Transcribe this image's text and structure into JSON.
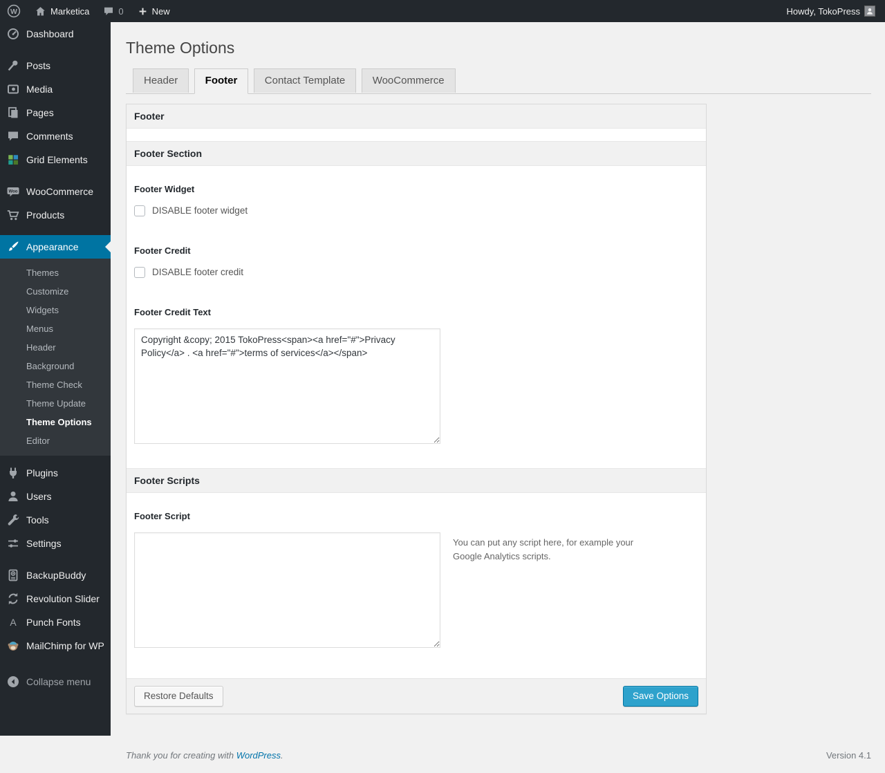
{
  "admin_bar": {
    "wp_logo": "W",
    "site_name": "Marketica",
    "comments_count": "0",
    "new_label": "New",
    "howdy": "Howdy, TokoPress"
  },
  "sidebar": {
    "menu": [
      {
        "label": "Dashboard"
      },
      {
        "label": "Posts"
      },
      {
        "label": "Media"
      },
      {
        "label": "Pages"
      },
      {
        "label": "Comments"
      },
      {
        "label": "Grid Elements"
      },
      {
        "label": "WooCommerce"
      },
      {
        "label": "Products"
      },
      {
        "label": "Appearance"
      },
      {
        "label": "Plugins"
      },
      {
        "label": "Users"
      },
      {
        "label": "Tools"
      },
      {
        "label": "Settings"
      },
      {
        "label": "BackupBuddy"
      },
      {
        "label": "Revolution Slider"
      },
      {
        "label": "Punch Fonts"
      },
      {
        "label": "MailChimp for WP"
      },
      {
        "label": "Collapse menu"
      }
    ],
    "appearance_submenu": [
      "Themes",
      "Customize",
      "Widgets",
      "Menus",
      "Header",
      "Background",
      "Theme Check",
      "Theme Update",
      "Theme Options",
      "Editor"
    ],
    "current_submenu_item": "Theme Options"
  },
  "main": {
    "page_title": "Theme Options",
    "tabs": [
      {
        "label": "Header",
        "active": false
      },
      {
        "label": "Footer",
        "active": true
      },
      {
        "label": "Contact Template",
        "active": false
      },
      {
        "label": "WooCommerce",
        "active": false
      }
    ],
    "panel": {
      "title": "Footer",
      "section_title": "Footer Section",
      "footer_widget_label": "Footer Widget",
      "footer_widget_checkbox": "DISABLE footer widget",
      "footer_credit_label": "Footer Credit",
      "footer_credit_checkbox": "DISABLE footer credit",
      "footer_credit_text_label": "Footer Credit Text",
      "footer_credit_text_value": "Copyright &copy; 2015 TokoPress<span><a href=\"#\">Privacy Policy</a> . <a href=\"#\">terms of services</a></span>",
      "scripts_title": "Footer Scripts",
      "footer_script_label": "Footer Script",
      "footer_script_value": "",
      "footer_script_help": "You can put any script here, for example your Google Analytics scripts.",
      "restore_button": "Restore Defaults",
      "save_button": "Save Options"
    }
  },
  "page_footer": {
    "thanks_prefix": "Thank you for creating with ",
    "wordpress_link": "WordPress",
    "thanks_suffix": ".",
    "version": "Version 4.1"
  },
  "colors": {
    "accent": "#0074a2",
    "primary_button": "#2ea2cc",
    "admin_dark": "#23282d",
    "submenu_bg": "#32373c",
    "page_bg": "#f1f1f1",
    "link": "#0073aa"
  }
}
